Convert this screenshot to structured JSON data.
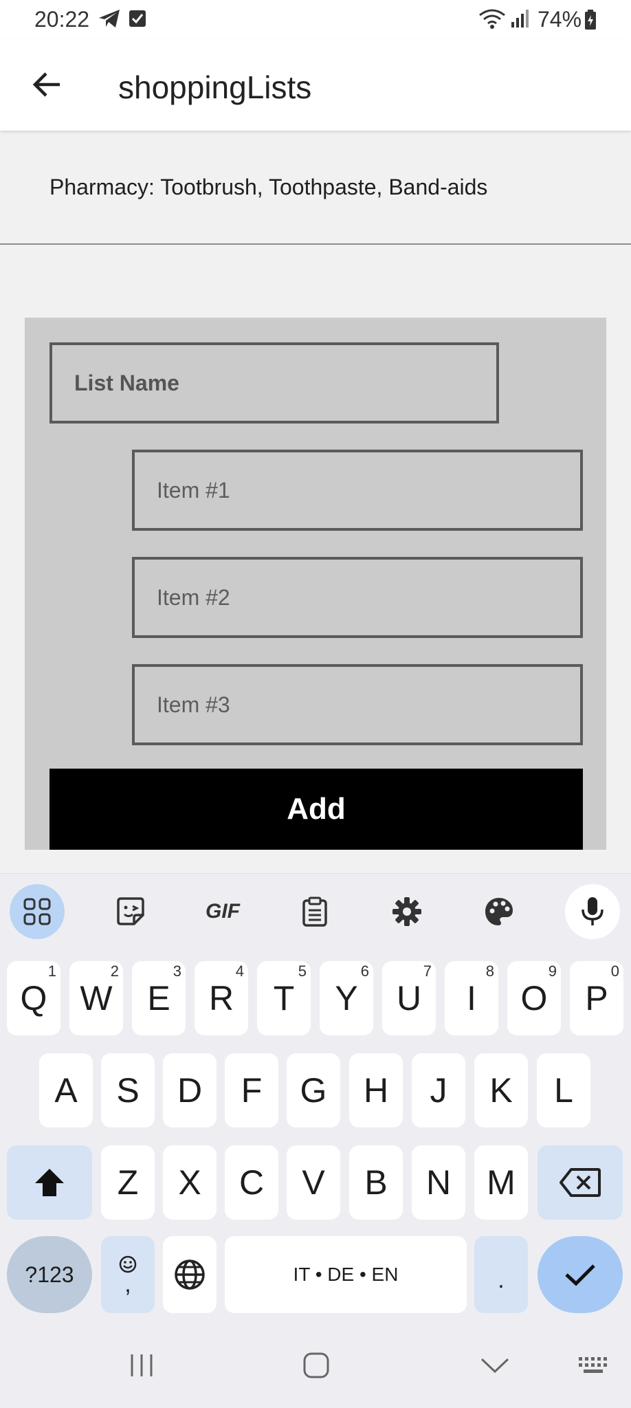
{
  "status_bar": {
    "time": "20:22",
    "battery_percent": "74%",
    "icons": [
      "telegram-icon",
      "checkbox-icon",
      "wifi-icon",
      "signal-icon",
      "battery-icon"
    ]
  },
  "app_bar": {
    "title": "shoppingLists",
    "back_icon": "arrow-left-icon"
  },
  "lists": [
    {
      "text": "Pharmacy: Tootbrush, Toothpaste, Band-aids"
    }
  ],
  "form": {
    "list_name_placeholder": "List Name",
    "items": [
      {
        "placeholder": "Item #1"
      },
      {
        "placeholder": "Item #2"
      },
      {
        "placeholder": "Item #3"
      }
    ],
    "add_label": "Add"
  },
  "keyboard": {
    "toolbar": [
      "apps-grid-icon",
      "sticker-icon",
      "GIF",
      "clipboard-icon",
      "gear-icon",
      "palette-icon",
      "mic-icon"
    ],
    "gif_label": "GIF",
    "row1": [
      {
        "k": "Q",
        "h": "1"
      },
      {
        "k": "W",
        "h": "2"
      },
      {
        "k": "E",
        "h": "3"
      },
      {
        "k": "R",
        "h": "4"
      },
      {
        "k": "T",
        "h": "5"
      },
      {
        "k": "Y",
        "h": "6"
      },
      {
        "k": "U",
        "h": "7"
      },
      {
        "k": "I",
        "h": "8"
      },
      {
        "k": "O",
        "h": "9"
      },
      {
        "k": "P",
        "h": "0"
      }
    ],
    "row2": [
      "A",
      "S",
      "D",
      "F",
      "G",
      "H",
      "J",
      "K",
      "L"
    ],
    "row3": [
      "Z",
      "X",
      "C",
      "V",
      "B",
      "N",
      "M"
    ],
    "symbols_label": "?123",
    "emoji_comma_label": ",",
    "space_label": "IT • DE • EN",
    "period_label": ".",
    "colors": {
      "accent": "#a6c8f4",
      "special_key": "#d6e3f4",
      "symbols_key": "#bccadb"
    }
  },
  "nav_bar": [
    "recents-icon",
    "home-icon",
    "back-chevron-icon",
    "keyboard-icon"
  ]
}
